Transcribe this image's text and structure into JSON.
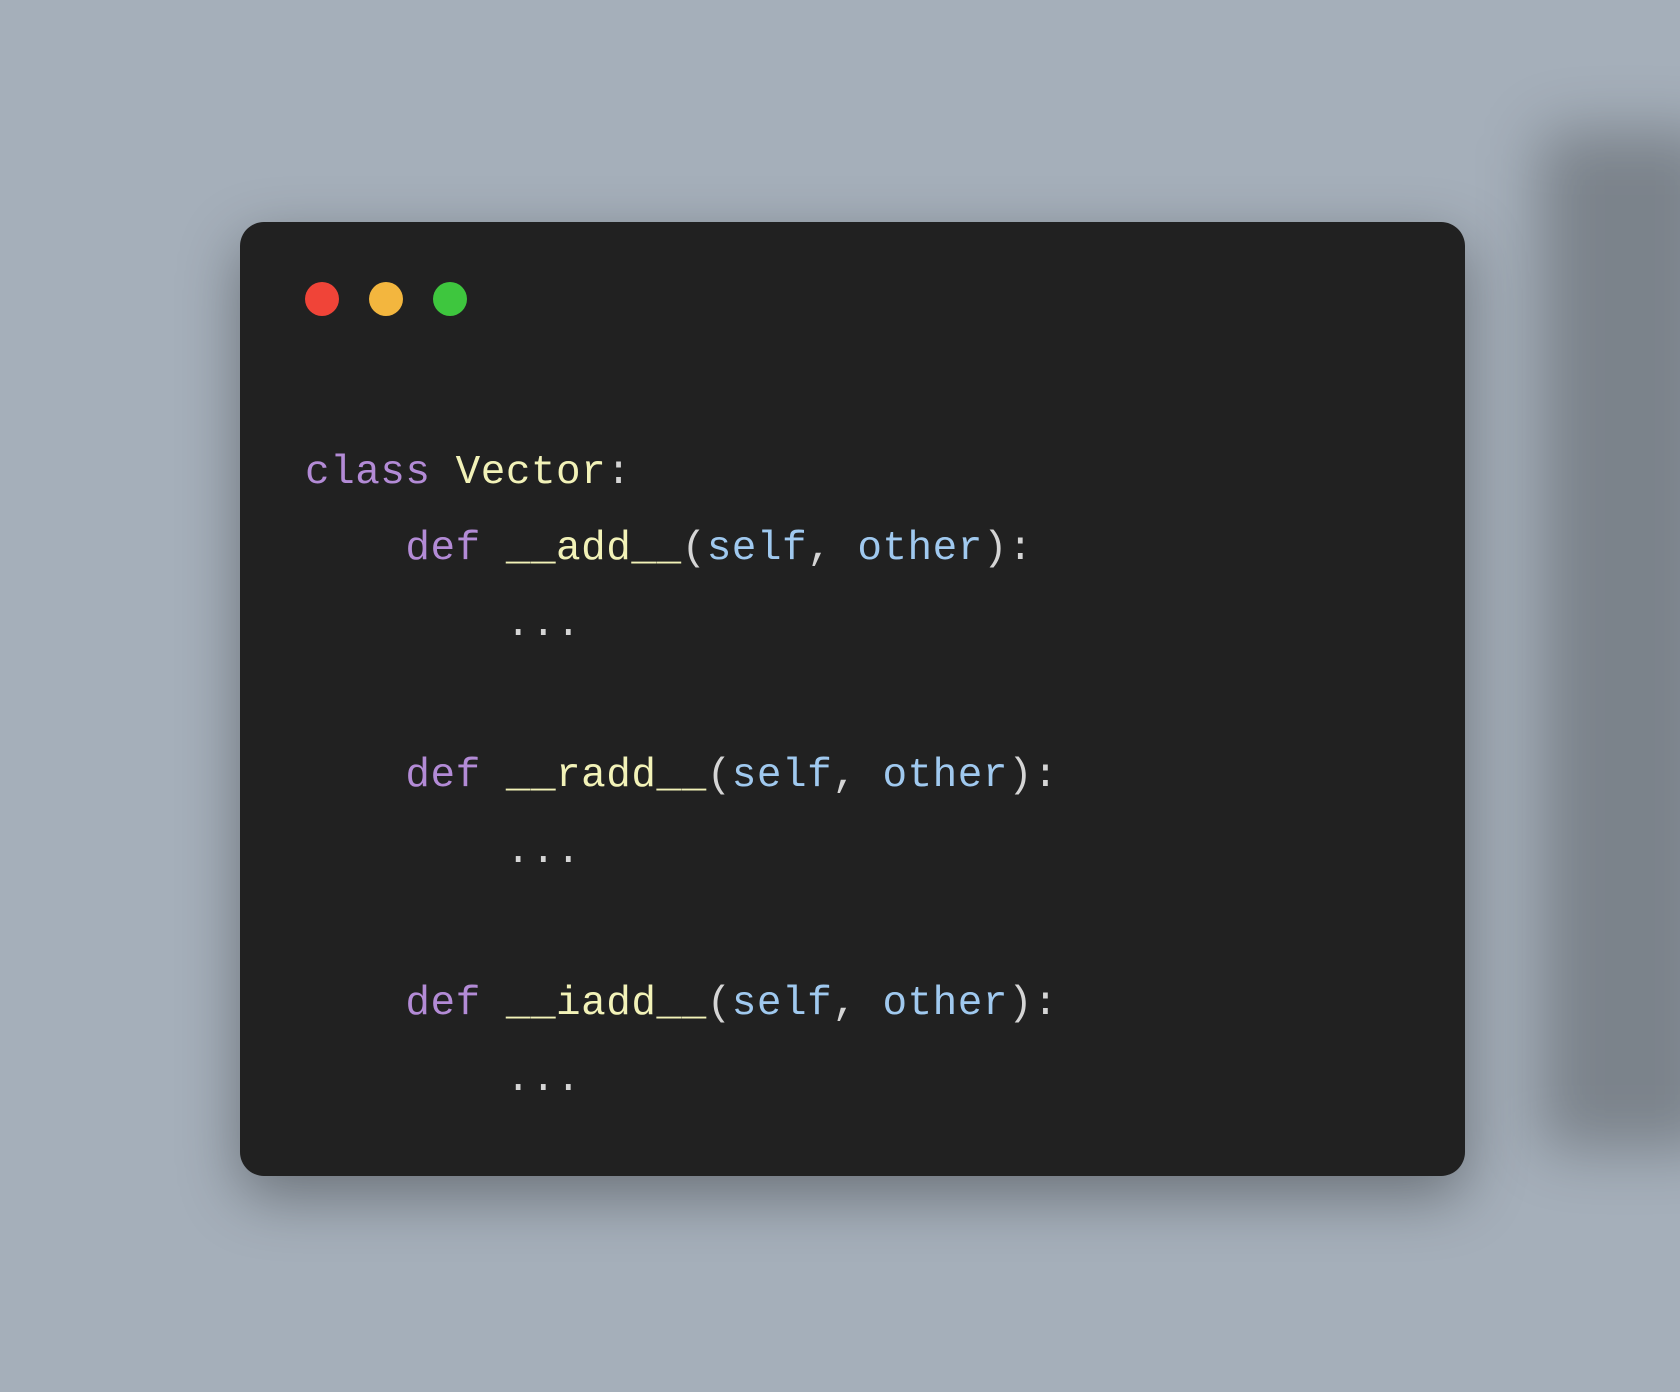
{
  "code": {
    "keywords": {
      "class": "class",
      "def": "def"
    },
    "className": "Vector",
    "methods": [
      {
        "name": "__add__",
        "params": [
          "self",
          "other"
        ],
        "body": "..."
      },
      {
        "name": "__radd__",
        "params": [
          "self",
          "other"
        ],
        "body": "..."
      },
      {
        "name": "__iadd__",
        "params": [
          "self",
          "other"
        ],
        "body": "..."
      }
    ],
    "punct": {
      "colon": ":",
      "lparen": "(",
      "rparen": ")",
      "comma": ", "
    }
  }
}
